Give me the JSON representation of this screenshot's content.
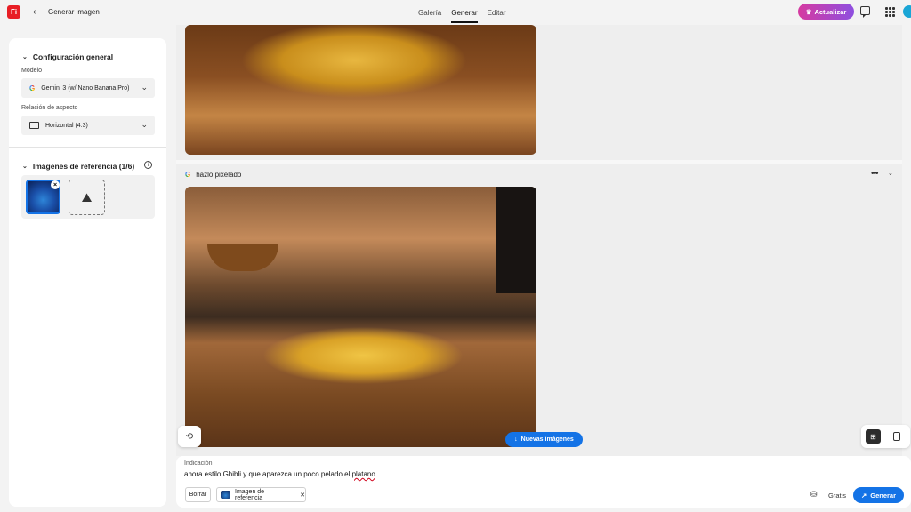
{
  "app": {
    "logo_text": "Fi",
    "page_title": "Generar imagen"
  },
  "nav": {
    "tabs": [
      "Galería",
      "Generar",
      "Editar"
    ],
    "active": "Generar"
  },
  "header": {
    "upgrade_label": "Actualizar"
  },
  "sidebar": {
    "general_title": "Configuración general",
    "model_label": "Modelo",
    "model_value": "Gemini 3 (w/ Nano Banana Pro)",
    "aspect_label": "Relación de aspecto",
    "aspect_value": "Horizontal (4:3)",
    "references_title": "Imágenes de referencia (1/6)"
  },
  "feed": {
    "prompt_title": "hazlo pixelado"
  },
  "buttons": {
    "new_images": "Nuevas imágenes"
  },
  "prompt": {
    "label": "Indicación",
    "text_before": "ahora estilo Ghibli y que aparezca un poco pelado el ",
    "text_misspelled": "platano",
    "clear_label": "Borrar",
    "reference_chip": "Imagen de referencia",
    "cost_label": "Gratis",
    "generate_label": "Generar"
  },
  "colors": {
    "accent": "#1473e6",
    "brand": "#e81e25"
  }
}
